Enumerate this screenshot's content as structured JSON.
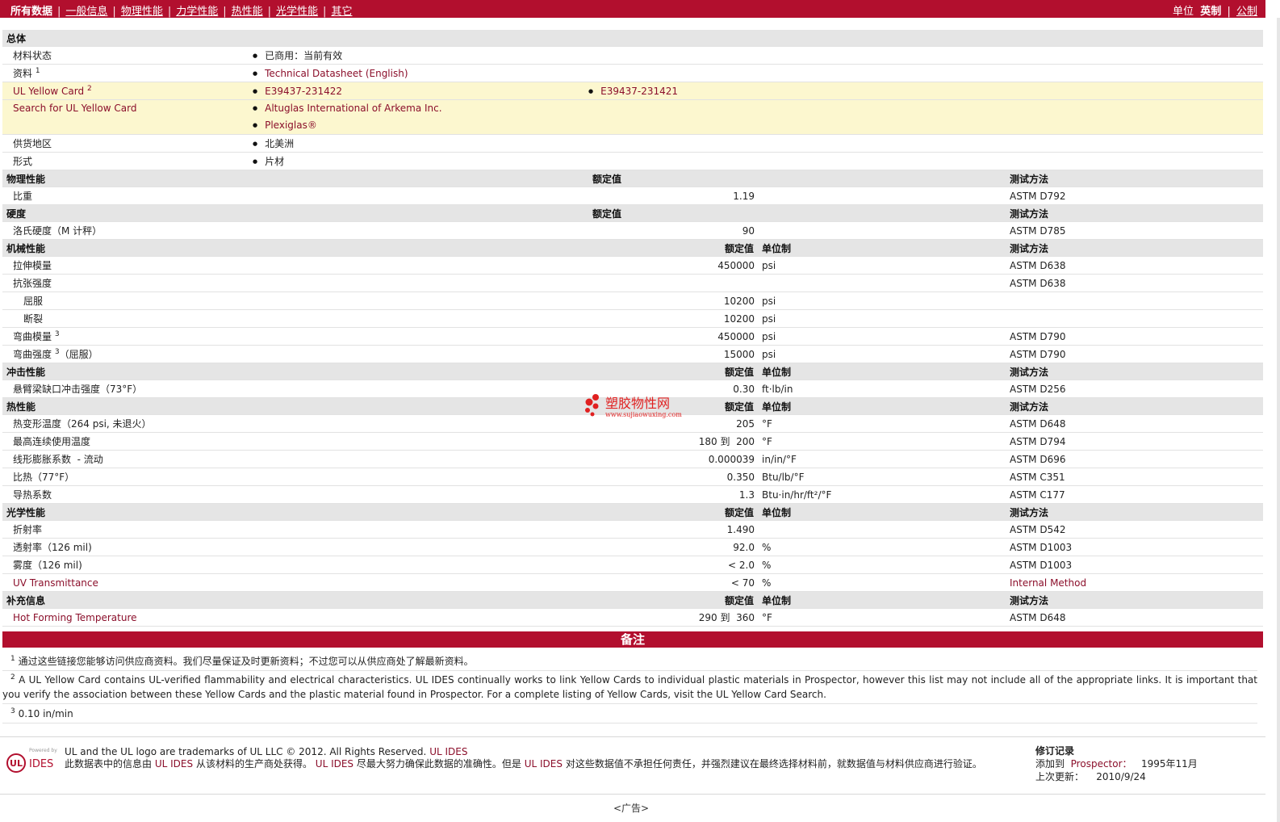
{
  "nav": {
    "items": [
      {
        "label": "所有数据",
        "current": true
      },
      {
        "label": "一般信息"
      },
      {
        "label": "物理性能"
      },
      {
        "label": "力学性能"
      },
      {
        "label": "热性能"
      },
      {
        "label": "光学性能"
      },
      {
        "label": "其它"
      }
    ],
    "units_label": "单位",
    "units_current": "英制",
    "units_other": "公制"
  },
  "general": {
    "title": "总体",
    "rows": {
      "status": {
        "label": "材料状态",
        "value": "已商用：当前有效"
      },
      "docs": {
        "label": "资料",
        "sup": "1",
        "value": "Technical Datasheet (English)"
      },
      "ulcard": {
        "label": "UL Yellow Card",
        "sup": "2",
        "value1": "E39437-231422",
        "value2": "E39437-231421"
      },
      "ulsearch": {
        "label": "Search for UL Yellow Card",
        "value1": "Altuglas International of Arkema Inc.",
        "value2": "Plexiglas®"
      },
      "region": {
        "label": "供货地区",
        "value": "北美洲"
      },
      "form": {
        "label": "形式",
        "value": "片材"
      }
    }
  },
  "headers": {
    "rated": "额定值",
    "unit": "单位制",
    "method": "测试方法"
  },
  "sections": {
    "physical": {
      "title": "物理性能",
      "r1": {
        "label": "比重",
        "value": "1.19",
        "unit": "",
        "method": "ASTM D792"
      }
    },
    "hardness": {
      "title": "硬度",
      "r1": {
        "label": "洛氏硬度（M 计秤）",
        "value": "90",
        "unit": "",
        "method": "ASTM D785"
      }
    },
    "mechanical": {
      "title": "机械性能",
      "r1": {
        "label": "拉伸模量",
        "value": "450000",
        "unit": "psi",
        "method": "ASTM D638"
      },
      "r2": {
        "label": "抗张强度",
        "value": "",
        "unit": "",
        "method": "ASTM D638"
      },
      "r3": {
        "label": "屈服",
        "value": "10200",
        "unit": "psi",
        "method": ""
      },
      "r4": {
        "label": "断裂",
        "value": "10200",
        "unit": "psi",
        "method": ""
      },
      "r5": {
        "label": "弯曲模量",
        "sup": "3",
        "value": "450000",
        "unit": "psi",
        "method": "ASTM D790"
      },
      "r6": {
        "label": "弯曲强度",
        "sup": "3",
        "suffix": "（屈服）",
        "value": "15000",
        "unit": "psi",
        "method": "ASTM D790"
      }
    },
    "impact": {
      "title": "冲击性能",
      "r1": {
        "label": "悬臂梁缺口冲击强度（73°F）",
        "value": "0.30",
        "unit": "ft·lb/in",
        "method": "ASTM D256"
      }
    },
    "thermal": {
      "title": "热性能",
      "r1": {
        "label": "热变形温度（264 psi, 未退火）",
        "value": "205",
        "unit": "°F",
        "method": "ASTM D648"
      },
      "r2": {
        "label": "最高连续使用温度",
        "value": "180 到  200",
        "unit": "°F",
        "method": "ASTM D794"
      },
      "r3": {
        "label": "线形膨胀系数  - 流动",
        "value": "0.000039",
        "unit": "in/in/°F",
        "method": "ASTM D696"
      },
      "r4": {
        "label": "比热（77°F）",
        "value": "0.350",
        "unit": "Btu/lb/°F",
        "method": "ASTM C351"
      },
      "r5": {
        "label": "导热系数",
        "value": "1.3",
        "unit": "Btu·in/hr/ft²/°F",
        "method": "ASTM C177"
      }
    },
    "optical": {
      "title": "光学性能",
      "r1": {
        "label": "折射率",
        "value": "1.490",
        "unit": "",
        "method": "ASTM D542"
      },
      "r2": {
        "label": "透射率（126 mil)",
        "value": "92.0",
        "unit": "%",
        "method": "ASTM D1003"
      },
      "r3": {
        "label": "雾度（126 mil)",
        "value": "< 2.0",
        "unit": "%",
        "method": "ASTM D1003"
      },
      "r4": {
        "label": "UV Transmittance",
        "value": "< 70",
        "unit": "%",
        "method": "Internal Method"
      }
    },
    "extra": {
      "title": "补充信息",
      "r1": {
        "label": "Hot Forming Temperature",
        "value": "290 到  360",
        "unit": "°F",
        "method": "ASTM D648"
      }
    }
  },
  "watermark": {
    "name": "塑胶物性网",
    "url": "www.sujiaowuxing.com"
  },
  "notes": {
    "title": "备注",
    "n1": {
      "num": "1",
      "text": "通过这些链接您能够访问供应商资料。我们尽量保证及时更新资料；不过您可以从供应商处了解最新资料。"
    },
    "n2": {
      "num": "2",
      "text": "A UL Yellow Card contains UL-verified flammability and electrical characteristics. UL IDES continually works to link Yellow Cards to individual plastic materials in Prospector, however this list may not include all of the appropriate links. It is important that you verify the association between these Yellow Cards and the plastic material found in Prospector. For a complete listing of Yellow Cards, visit the UL Yellow Card Search."
    },
    "n3": {
      "num": "3",
      "text": "0.10 in/min"
    }
  },
  "footer": {
    "logo_powered": "Powered by",
    "logo_ul": "UL",
    "logo_ides": "IDES",
    "trademark": "UL and the UL logo are trademarks of UL LLC © 2012. All Rights Reserved.",
    "trademark_link": "UL IDES",
    "disclaimer_a": "此数据表中的信息由",
    "disclaimer_link1": "UL IDES",
    "disclaimer_b": "从该材料的生产商处获得。",
    "disclaimer_link2": "UL IDES",
    "disclaimer_c": "尽最大努力确保此数据的准确性。但是",
    "disclaimer_link3": "UL IDES",
    "disclaimer_d": "对这些数据值不承担任何责任，并强烈建议在最终选择材料前，就数据值与材料供应商进行验证。",
    "rev_title": "修订记录",
    "rev_added_label": "添加到",
    "rev_added_link": "Prospector：",
    "rev_added_date": "1995年11月",
    "rev_updated_label": "上次更新：",
    "rev_updated_date": "2010/9/24",
    "ad": "<广告>"
  },
  "colors": {
    "brand": "#b20f2e",
    "link": "#8b0f2b",
    "highlight": "#fcf7cf",
    "section": "#e5e5e5"
  }
}
